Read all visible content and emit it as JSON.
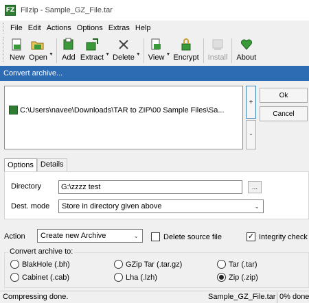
{
  "window": {
    "title": "Filzip - Sample_GZ_File.tar",
    "app_icon_text": "FZ"
  },
  "menu": [
    "File",
    "Edit",
    "Actions",
    "Options",
    "Extras",
    "Help"
  ],
  "toolbar": {
    "new": "New",
    "open": "Open",
    "add": "Add",
    "extract": "Extract",
    "delete": "Delete",
    "view": "View",
    "encrypt": "Encrypt",
    "install": "Install",
    "about": "About",
    "icons": {
      "new": "new-archive-icon",
      "open": "open-folder-icon",
      "add": "add-files-icon",
      "extract": "extract-icon",
      "delete": "delete-x-icon",
      "view": "view-icon",
      "encrypt": "lock-icon",
      "install": "install-icon",
      "about": "about-heart-icon"
    }
  },
  "dialog": {
    "title": "Convert archive...",
    "file_path": "C:\\Users\\navee\\Downloads\\TAR to ZIP\\00 Sample Files\\Sa...",
    "plus": "+",
    "minus": "-",
    "ok": "Ok",
    "cancel": "Cancel",
    "tabs": [
      "Options",
      "Details"
    ],
    "directory_label": "Directory",
    "directory_value": "G:\\zzzz test",
    "browse": "...",
    "dest_mode_label": "Dest. mode",
    "dest_mode_value": "Store in directory given above",
    "action_label": "Action",
    "action_value": "Create new Archive",
    "delete_source_label": "Delete source file",
    "delete_source_checked": false,
    "integrity_label": "Integrity check",
    "integrity_checked": true,
    "convert_to_label": "Convert archive to:",
    "formats": [
      {
        "label": "BlakHole (.bh)",
        "selected": false
      },
      {
        "label": "GZip Tar (.tar.gz)",
        "selected": false
      },
      {
        "label": "Tar (.tar)",
        "selected": false
      },
      {
        "label": "Cabinet (.cab)",
        "selected": false
      },
      {
        "label": "Lha (.lzh)",
        "selected": false
      },
      {
        "label": "Zip (.zip)",
        "selected": true
      }
    ]
  },
  "status": {
    "message": "Compressing done.",
    "file": "Sample_GZ_File.tar",
    "progress": "0% done"
  },
  "colors": {
    "accent": "#2d6bb3",
    "check": "#222222"
  }
}
